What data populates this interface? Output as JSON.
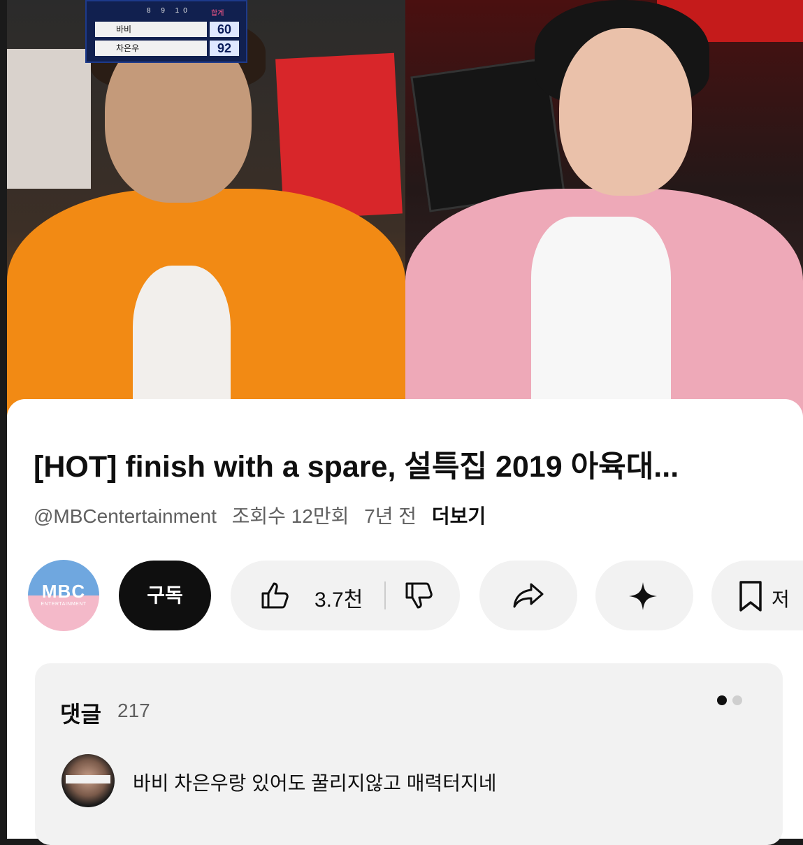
{
  "scoreboard": {
    "round_numbers": "8 9 10",
    "total_label": "합계",
    "rows": [
      {
        "name": "바비",
        "score": "60"
      },
      {
        "name": "차은우",
        "score": "92"
      }
    ]
  },
  "video": {
    "title": "[HOT] finish with a spare, 설특집 2019 아육대...",
    "channel_handle": "@MBCentertainment",
    "views": "조회수 12만회",
    "age": "7년 전",
    "more_label": "더보기"
  },
  "channel_avatar": {
    "logo_text": "MBC",
    "sub_text": "ENTERTAINMENT"
  },
  "actions": {
    "subscribe_label": "구독",
    "like_count": "3.7천",
    "save_label_partial": "저"
  },
  "icons": {
    "like": "thumbs-up-icon",
    "dislike": "thumbs-down-icon",
    "share": "share-icon",
    "remix": "sparkle-icon",
    "save": "bookmark-icon"
  },
  "comments": {
    "header": "댓글",
    "count": "217",
    "first_comment": "바비 차은우랑 있어도 꿀리지않고 매력터지네"
  },
  "colors": {
    "subscribe_bg": "#0f0f0f",
    "pill_bg": "#f2f2f2",
    "comment_bg": "#f2f2f2",
    "text_primary": "#0f0f0f",
    "text_secondary": "#606060"
  }
}
